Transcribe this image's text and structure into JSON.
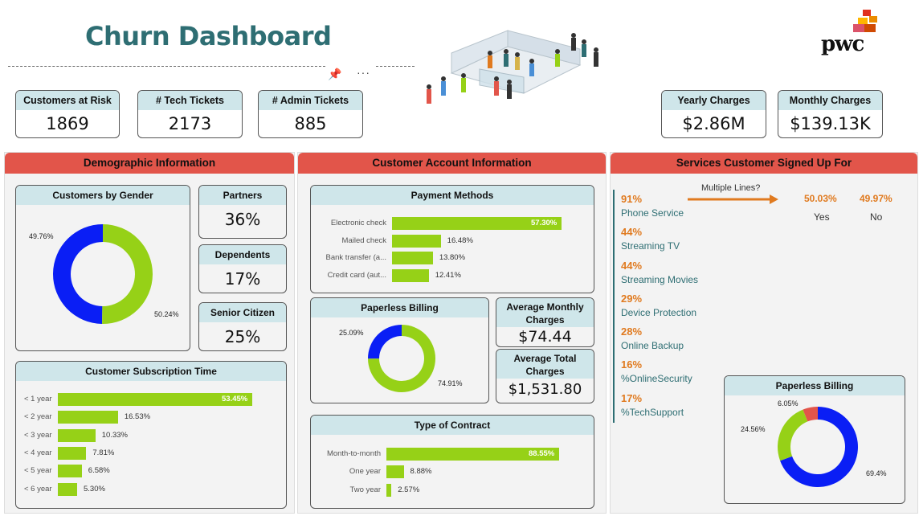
{
  "header": {
    "title": "Churn Dashboard",
    "logo_text": "pwc"
  },
  "kpis": {
    "customers_at_risk": {
      "label": "Customers at Risk",
      "value": "1869"
    },
    "tech_tickets": {
      "label": "# Tech Tickets",
      "value": "2173"
    },
    "admin_tickets": {
      "label": "# Admin Tickets",
      "value": "885"
    },
    "yearly_charges": {
      "label": "Yearly Charges",
      "value": "$2.86M"
    },
    "monthly_charges": {
      "label": "Monthly Charges",
      "value": "$139.13K"
    }
  },
  "panels": {
    "demographic": "Demographic Information",
    "account": "Customer Account Information",
    "services": "Services Customer Signed Up For"
  },
  "gender": {
    "title": "Customers by Gender",
    "values": [
      49.76,
      50.24
    ],
    "labels": [
      "49.76%",
      "50.24%"
    ],
    "colors": [
      "#0a1ef5",
      "#96d117"
    ]
  },
  "partners": {
    "label": "Partners",
    "value": "36%"
  },
  "dependents": {
    "label": "Dependents",
    "value": "17%"
  },
  "senior": {
    "label": "Senior Citizen",
    "value": "25%"
  },
  "subscription": {
    "title": "Customer Subscription Time",
    "rows": [
      {
        "label": "< 1 year",
        "value": 53.45,
        "text": "53.45%"
      },
      {
        "label": "< 2 year",
        "value": 16.53,
        "text": "16.53%"
      },
      {
        "label": "< 3 year",
        "value": 10.33,
        "text": "10.33%"
      },
      {
        "label": "< 4 year",
        "value": 7.81,
        "text": "7.81%"
      },
      {
        "label": "< 5 year",
        "value": 6.58,
        "text": "6.58%"
      },
      {
        "label": "< 6 year",
        "value": 5.3,
        "text": "5.30%"
      }
    ]
  },
  "payment": {
    "title": "Payment Methods",
    "rows": [
      {
        "label": "Electronic check",
        "value": 57.3,
        "text": "57.30%"
      },
      {
        "label": "Mailed check",
        "value": 16.48,
        "text": "16.48%"
      },
      {
        "label": "Bank transfer (a...",
        "value": 13.8,
        "text": "13.80%"
      },
      {
        "label": "Credit card (aut...",
        "value": 12.41,
        "text": "12.41%"
      }
    ]
  },
  "paperless_mid": {
    "title": "Paperless Billing",
    "values": [
      25.09,
      74.91
    ],
    "labels": [
      "25.09%",
      "74.91%"
    ],
    "colors": [
      "#0a1ef5",
      "#96d117"
    ]
  },
  "avg_monthly": {
    "label": "Average Monthly Charges",
    "value": "$74.44"
  },
  "avg_total": {
    "label": "Average Total Charges",
    "value": "$1,531.80"
  },
  "contract": {
    "title": "Type of Contract",
    "rows": [
      {
        "label": "Month-to-month",
        "value": 88.55,
        "text": "88.55%"
      },
      {
        "label": "One year",
        "value": 8.88,
        "text": "8.88%"
      },
      {
        "label": "Two year",
        "value": 2.57,
        "text": "2.57%"
      }
    ]
  },
  "services": {
    "multiple_lines_label": "Multiple Lines?",
    "yes_pct": "50.03%",
    "yes_label": "Yes",
    "no_pct": "49.97%",
    "no_label": "No",
    "items": [
      {
        "pct": "91%",
        "name": "Phone Service"
      },
      {
        "pct": "44%",
        "name": "Streaming TV"
      },
      {
        "pct": "44%",
        "name": "Streaming Movies"
      },
      {
        "pct": "29%",
        "name": "Device Protection"
      },
      {
        "pct": "28%",
        "name": "Online Backup"
      },
      {
        "pct": "16%",
        "name": "%OnlineSecurity"
      },
      {
        "pct": "17%",
        "name": "%TechSupport"
      }
    ]
  },
  "paperless_right": {
    "title": "Paperless Billing",
    "values": [
      69.4,
      24.56,
      6.05
    ],
    "labels": [
      "69.4%",
      "24.56%",
      "6.05%"
    ],
    "colors": [
      "#0a1ef5",
      "#96d117",
      "#e2554a"
    ]
  },
  "colors": {
    "accent_red": "#e2554a",
    "teal": "#2e6e73",
    "green": "#96d117",
    "blue": "#0a1ef5",
    "orange": "#e07a1f"
  }
}
